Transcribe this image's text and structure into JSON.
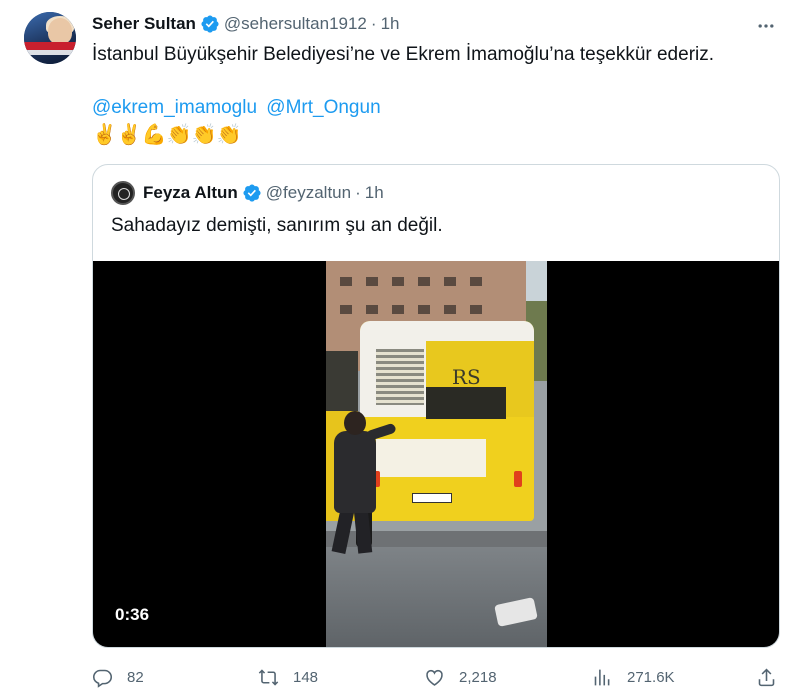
{
  "tweet": {
    "author_name": "Seher Sultan",
    "author_handle": "@sehersultan1912",
    "separator": "·",
    "time": "1h",
    "text": "İstanbul Büyükşehir Belediyesi’ne ve Ekrem İmamoğlu’na teşekkür ederiz.",
    "mentions": [
      "@ekrem_imamoglu",
      "@Mrt_Ongun"
    ],
    "emojis": "✌️✌️💪👏👏👏"
  },
  "quoted": {
    "author_name": "Feyza Altun",
    "author_handle": "@feyzaltun",
    "separator": "·",
    "time": "1h",
    "text": "Sahadayız demişti, sanırım şu an değil.",
    "video": {
      "duration": "0:36",
      "bus_logo": "RS"
    }
  },
  "actions": {
    "replies": "82",
    "retweets": "148",
    "likes": "2,218",
    "views": "271.6K"
  },
  "colors": {
    "link": "#1d9bf0",
    "secondary_text": "#536471",
    "verified": "#1d9bf0",
    "border": "#cfd9de"
  },
  "icons": {
    "verified": "verified-badge-icon",
    "more": "more-horizontal-icon",
    "reply": "reply-icon",
    "retweet": "retweet-icon",
    "like": "heart-icon",
    "views": "bar-chart-icon",
    "share": "share-icon"
  }
}
